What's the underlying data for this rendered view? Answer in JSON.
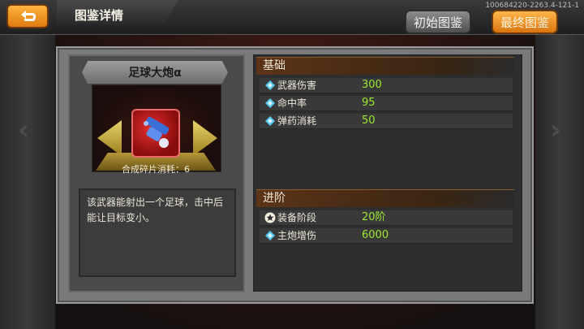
{
  "header": {
    "back_icon": "return-arrow-icon",
    "title": "图鉴详情",
    "version": "100684220-2263.4-121-1",
    "btn_initial": "初始图鉴",
    "btn_final": "最终图鉴"
  },
  "item": {
    "name": "足球大炮α",
    "fragment_cost": "合成碎片消耗：6",
    "description": "该武器能射出一个足球，击中后能让目标变小。",
    "icon": "soccer-cannon-icon"
  },
  "sections": {
    "base": {
      "title": "基础",
      "rows": [
        {
          "label": "武器伤害",
          "value": "300",
          "icon": "diamond-icon"
        },
        {
          "label": "命中率",
          "value": "95",
          "icon": "diamond-icon"
        },
        {
          "label": "弹药消耗",
          "value": "50",
          "icon": "diamond-icon"
        }
      ]
    },
    "advanced": {
      "title": "进阶",
      "rows": [
        {
          "label": "装备阶段",
          "value": "20阶",
          "icon": "star-icon"
        },
        {
          "label": "主炮增伤",
          "value": "6000",
          "icon": "diamond-icon"
        }
      ]
    }
  },
  "colors": {
    "accent_orange": "#f0951e",
    "value_green": "#9bea32"
  }
}
